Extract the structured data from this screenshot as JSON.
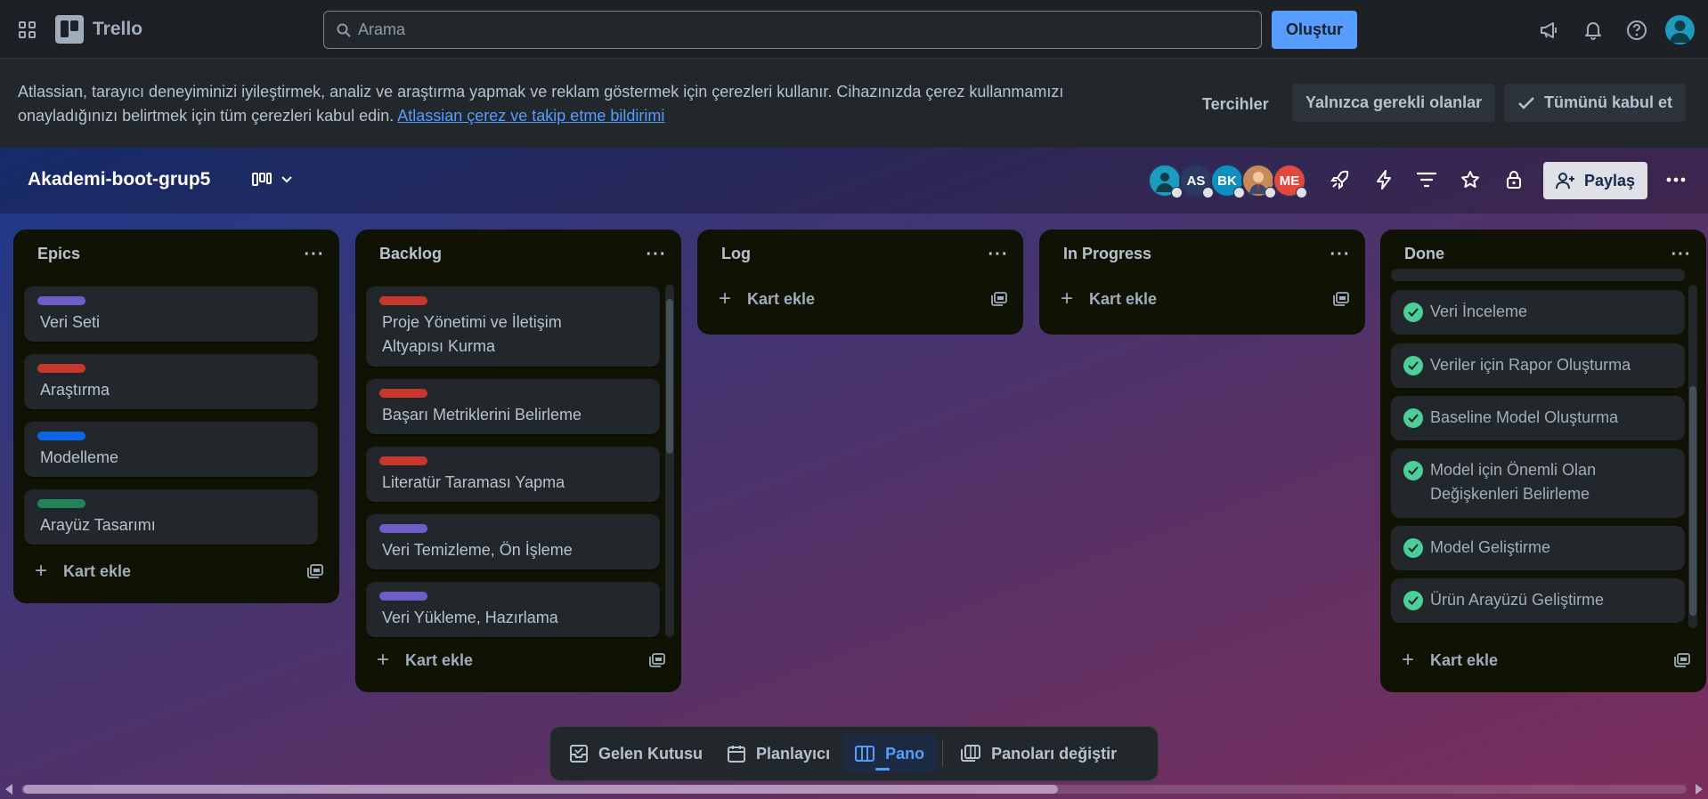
{
  "topbar": {
    "app_name": "Trello",
    "search_placeholder": "Arama",
    "create_label": "Oluştur",
    "icons": [
      "apps-grid-icon",
      "trello-logo-icon",
      "search-icon",
      "megaphone-icon",
      "bell-icon",
      "help-icon",
      "user-avatar-icon"
    ]
  },
  "cookie_banner": {
    "text": "Atlassian, tarayıcı deneyiminizi iyileştirmek, analiz ve araştırma yapmak ve reklam göstermek için çerezleri kullanır. Cihazınızda çerez kullanmamızı onayladığınızı belirtmek için tüm çerezleri kabul edin.",
    "link_text": "Atlassian çerez ve takip etme bildirimi",
    "preferences_label": "Tercihler",
    "necessary_label": "Yalnızca gerekli olanlar",
    "accept_all_label": "Tümünü kabul et"
  },
  "board": {
    "title": "Akademi-boot-grup5",
    "members": [
      {
        "initials": "",
        "color": "#1d9bbf"
      },
      {
        "initials": "AS",
        "color": "#2b3a61"
      },
      {
        "initials": "BK",
        "color": "#0f8fbd"
      },
      {
        "initials": "",
        "color": "#c98a5a"
      },
      {
        "initials": "ME",
        "color": "#e2483d"
      }
    ],
    "share_label": "Paylaş",
    "header_icons": [
      "board-view-icon",
      "chevron-down-icon",
      "power-ups-icon",
      "automation-icon",
      "filter-icon",
      "star-icon",
      "lock-icon",
      "more-icon"
    ]
  },
  "lists": [
    {
      "title": "Epics",
      "add_label": "Kart ekle",
      "cards": [
        {
          "title": "Veri Seti",
          "label_color": "#6e5dc6"
        },
        {
          "title": "Araştırma",
          "label_color": "#c9372c"
        },
        {
          "title": "Modelleme",
          "label_color": "#0c66e4"
        },
        {
          "title": "Arayüz Tasarımı",
          "label_color": "#1f845a"
        }
      ]
    },
    {
      "title": "Backlog",
      "add_label": "Kart ekle",
      "cards": [
        {
          "title": "Proje Yönetimi ve İletişim Altyapısı Kurma",
          "label_color": "#c9372c"
        },
        {
          "title": "Başarı Metriklerini Belirleme",
          "label_color": "#c9372c"
        },
        {
          "title": "Literatür Taraması Yapma",
          "label_color": "#c9372c"
        },
        {
          "title": "Veri Temizleme, Ön İşleme",
          "label_color": "#6e5dc6"
        },
        {
          "title": "Veri Yükleme, Hazırlama",
          "label_color": "#6e5dc6"
        }
      ]
    },
    {
      "title": "Log",
      "add_label": "Kart ekle",
      "cards": []
    },
    {
      "title": "In Progress",
      "add_label": "Kart ekle",
      "cards": []
    },
    {
      "title": "Done",
      "add_label": "Kart ekle",
      "cards": [
        {
          "title": "Veri İnceleme"
        },
        {
          "title": "Veriler için Rapor Oluşturma"
        },
        {
          "title": "Baseline Model Oluşturma"
        },
        {
          "title": "Model için Önemli Olan Değişkenleri Belirleme"
        },
        {
          "title": "Model Geliştirme"
        },
        {
          "title": "Ürün Arayüzü Geliştirme"
        }
      ]
    }
  ],
  "bottom_nav": {
    "inbox": "Gelen Kutusu",
    "planner": "Planlayıcı",
    "board": "Pano",
    "switch_boards": "Panoları değiştir",
    "active": "Pano"
  }
}
